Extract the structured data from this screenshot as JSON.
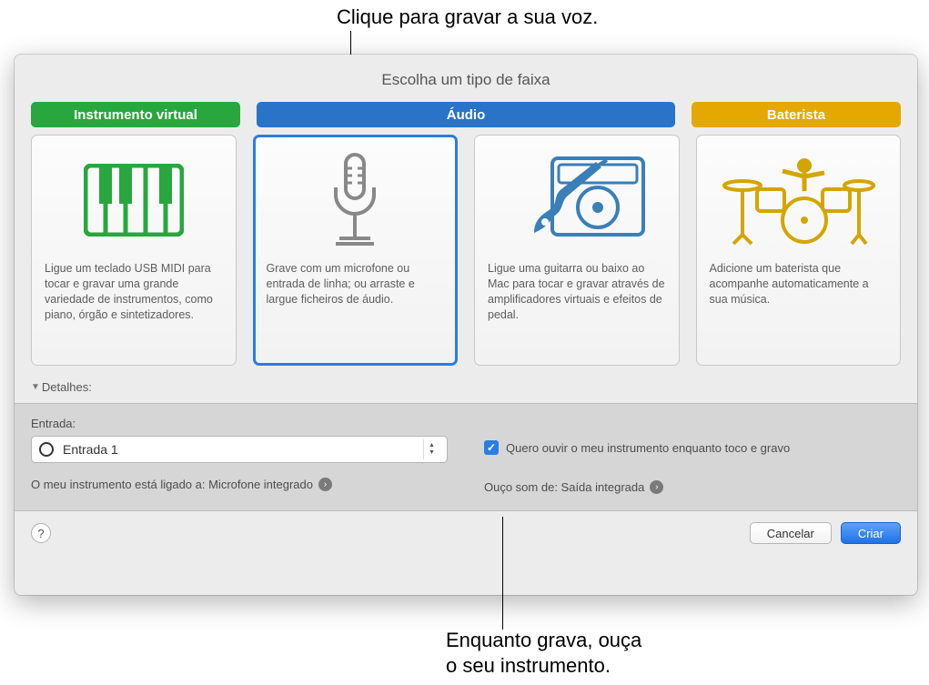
{
  "annotations": {
    "top": "Clique para gravar a sua voz.",
    "bottom_line1": "Enquanto grava, ouça",
    "bottom_line2": "o seu instrumento."
  },
  "dialog": {
    "title": "Escolha um tipo de faixa"
  },
  "tabs": {
    "virtual": "Instrumento virtual",
    "audio": "Áudio",
    "drummer": "Baterista"
  },
  "cards": {
    "virtual": {
      "desc": "Ligue um teclado USB MIDI para tocar e gravar uma grande variedade de instrumentos, como piano, órgão e sintetizadores."
    },
    "mic": {
      "desc": "Grave com um microfone ou entrada de linha; ou arraste e largue ficheiros de áudio."
    },
    "guitar": {
      "desc": "Ligue uma guitarra ou baixo ao Mac para tocar e gravar através de amplificadores virtuais e efeitos de pedal."
    },
    "drummer": {
      "desc": "Adicione um baterista que acompanhe automaticamente a sua música."
    }
  },
  "details": {
    "label": "Detalhes:",
    "input_label": "Entrada:",
    "input_value": "Entrada 1",
    "connected_text": "O meu instrumento está ligado a: Microfone integrado",
    "monitor_checkbox": "Quero ouvir o meu instrumento enquanto toco e gravo",
    "output_text": "Ouço som de: Saída integrada"
  },
  "footer": {
    "cancel": "Cancelar",
    "create": "Criar"
  }
}
